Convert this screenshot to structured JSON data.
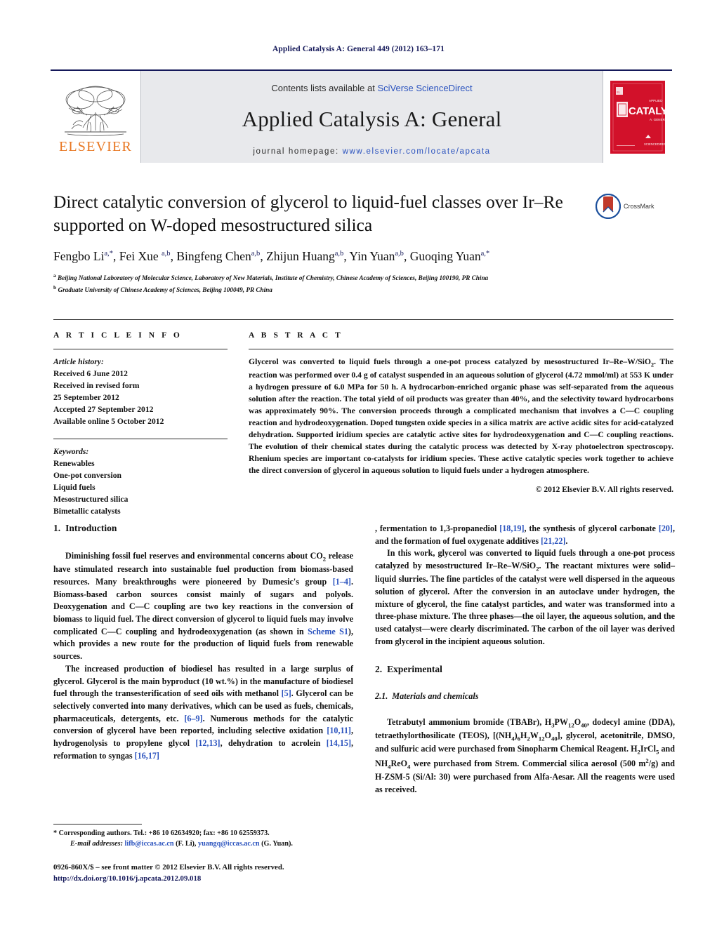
{
  "running_head": "Applied Catalysis A: General 449 (2012) 163–171",
  "masthead": {
    "contents_prefix": "Contents lists available at ",
    "sciencedirect": "SciVerse ScienceDirect",
    "journal_title": "Applied Catalysis A: General",
    "homepage_prefix": "journal homepage: ",
    "homepage_url": "www.elsevier.com/locate/apcata",
    "publisher_wordmark": "ELSEVIER",
    "cover_title": "CATALYSIS",
    "cover_sup": "APPLIED",
    "cover_sub": "A: GENERAL",
    "link_color": "#2a52be",
    "elsevier_orange": "#e87722",
    "cover_red": "#d2112a"
  },
  "article": {
    "title": "Direct catalytic conversion of glycerol to liquid-fuel classes over Ir–Re supported on W-doped mesostructured silica",
    "crossmark_label": "CrossMark",
    "authors_html": "Fengbo Li<sup>a,*</sup>, Fei Xue <sup>a,b</sup>, Bingfeng Chen<sup>a,b</sup>, Zhijun Huang<sup>a,b</sup>, Yin Yuan<sup>a,b</sup>, Guoqing Yuan<sup>a,*</sup>",
    "affiliation_a": "Beijing National Laboratory of Molecular Science, Laboratory of New Materials, Institute of Chemistry, Chinese Academy of Sciences, Beijing 100190, PR China",
    "affiliation_b": "Graduate University of Chinese Academy of Sciences, Beijing 100049, PR China"
  },
  "article_info": {
    "heading": "A R T I C L E   I N F O",
    "history_label": "Article history:",
    "history": [
      "Received 6 June 2012",
      "Received in revised form",
      "25 September 2012",
      "Accepted 27 September 2012",
      "Available online 5 October 2012"
    ],
    "keywords_label": "Keywords:",
    "keywords": [
      "Renewables",
      "One-pot conversion",
      "Liquid fuels",
      "Mesostructured silica",
      "Bimetallic catalysts"
    ]
  },
  "abstract": {
    "heading": "A B S T R A C T",
    "text_part1": "Glycerol was converted to liquid fuels through a one-pot process catalyzed by mesostructured Ir–Re–W/SiO",
    "formula_sub1": "2",
    "text_part2": ". The reaction was performed over 0.4 g of catalyst suspended in an aqueous solution of glycerol (4.72 mmol/ml) at 553 K under a hydrogen pressure of 6.0 MPa for 50 h. A hydrocarbon-enriched organic phase was self-separated from the aqueous solution after the reaction. The total yield of oil products was greater than 40%, and the selectivity toward hydrocarbons was approximately 90%. The conversion proceeds through a complicated mechanism that involves a C—C coupling reaction and hydrodeoxygenation. Doped tungsten oxide species in a silica matrix are active acidic sites for acid-catalyzed dehydration. Supported iridium species are catalytic active sites for hydrodeoxygenation and C—C coupling reactions. The evolution of their chemical states during the catalytic process was detected by X-ray photoelectron spectroscopy. Rhenium species are important co-catalysts for iridium species. These active catalytic species work together to achieve the direct conversion of glycerol in aqueous solution to liquid fuels under a hydrogen atmosphere.",
    "copyright": "© 2012 Elsevier B.V. All rights reserved."
  },
  "sections": {
    "introduction": {
      "number": "1.",
      "title": "Introduction"
    },
    "experimental": {
      "number": "2.",
      "title": "Experimental"
    },
    "materials": {
      "number": "2.1.",
      "title": "Materials and chemicals"
    }
  },
  "body": {
    "intro_p1_a": "Diminishing fossil fuel reserves and environmental concerns about CO",
    "intro_p1_sub": "2",
    "intro_p1_b": " release have stimulated research into sustainable fuel production from biomass-based resources. Many breakthroughs were pioneered by Dumesic's group ",
    "intro_p1_ref1": "[1–4]",
    "intro_p1_c": ". Biomass-based carbon sources consist mainly of sugars and polyols. Deoxygenation and C—C coupling are two key reactions in the conversion of biomass to liquid fuel. The direct conversion of glycerol to liquid fuels may involve complicated C—C coupling and hydrodeoxygenation (as shown in ",
    "intro_p1_ref2": "Scheme S1",
    "intro_p1_d": "), which provides a new route for the production of liquid fuels from renewable sources.",
    "intro_p2_a": "The increased production of biodiesel has resulted in a large surplus of glycerol. Glycerol is the main byproduct (10 wt.%) in the manufacture of biodiesel fuel through the transesterification of seed oils with methanol ",
    "intro_p2_ref1": "[5]",
    "intro_p2_b": ". Glycerol can be selectively converted into many derivatives, which can be used as fuels, chemicals, pharmaceuticals, detergents, etc. ",
    "intro_p2_ref2": "[6–9]",
    "intro_p2_c": ". Numerous methods for the catalytic conversion of glycerol have been reported, including selective oxidation ",
    "intro_p2_ref3": "[10,11]",
    "intro_p2_d": ", hydrogenolysis to propylene glycol ",
    "intro_p2_ref4": "[12,13]",
    "intro_p2_e": ", dehydration to acrolein ",
    "intro_p2_ref5": "[14,15]",
    "intro_p2_f": ", reformation to syngas ",
    "intro_p2_ref6": "[16,17]",
    "intro_p2_g": ", fermentation to 1,3-propanediol ",
    "intro_p2_ref7": "[18,19]",
    "intro_p2_h": ", the synthesis of glycerol carbonate ",
    "intro_p2_ref8": "[20]",
    "intro_p2_i": ", and the formation of fuel oxygenate additives ",
    "intro_p2_ref9": "[21,22]",
    "intro_p2_j": ".",
    "intro_p3_a": "In this work, glycerol was converted to liquid fuels through a one-pot process catalyzed by mesostructured Ir–Re–W/SiO",
    "intro_p3_sub": "2",
    "intro_p3_b": ". The reactant mixtures were solid–liquid slurries. The fine particles of the catalyst were well dispersed in the aqueous solution of glycerol. After the conversion in an autoclave under hydrogen, the mixture of glycerol, the fine catalyst particles, and water was transformed into a three-phase mixture. The three phases—the oil layer, the aqueous solution, and the used catalyst—were clearly discriminated. The carbon of the oil layer was derived from glycerol in the incipient aqueous solution."
  },
  "materials_paragraph": {
    "t1": "Tetrabutyl ammonium bromide (TBABr), H",
    "s1": "3",
    "t2": "PW",
    "s2": "12",
    "t3": "O",
    "s3": "40",
    "t4": ", dodecyl amine (DDA), tetraethylorthosilicate (TEOS), [(NH",
    "s4": "4",
    "t5": ")",
    "s5": "6",
    "t6": "H",
    "s6": "2",
    "t7": "W",
    "s7": "12",
    "t8": "O",
    "s8": "40",
    "t9": "], glycerol, acetonitrile, DMSO, and sulfuric acid were purchased from Sinopharm Chemical Reagent. H",
    "s9": "2",
    "t10": "IrCl",
    "s10": "5",
    "t11": " and NH",
    "s11": "4",
    "t12": "ReO",
    "s12": "4",
    "t13": " were purchased from Strem. Commercial silica aerosol (500 m",
    "sup13": "2",
    "t14": "/g) and H-ZSM-5 (Si/Al: 30) were purchased from Alfa-Aesar. All the reagents were used as received."
  },
  "footnote": {
    "star": "*",
    "corresponding": " Corresponding authors. Tel.: +86 10 62634920; fax: +86 10 62559373.",
    "email_label": "E-mail addresses:",
    "email1": "lifb@iccas.ac.cn",
    "email1_owner": " (F. Li),",
    "email2": "yuangq@iccas.ac.cn",
    "email2_owner": " (G. Yuan)."
  },
  "imprint": {
    "line1": "0926-860X/$ – see front matter © 2012 Elsevier B.V. All rights reserved.",
    "doi": "http://dx.doi.org/10.1016/j.apcata.2012.09.018"
  }
}
